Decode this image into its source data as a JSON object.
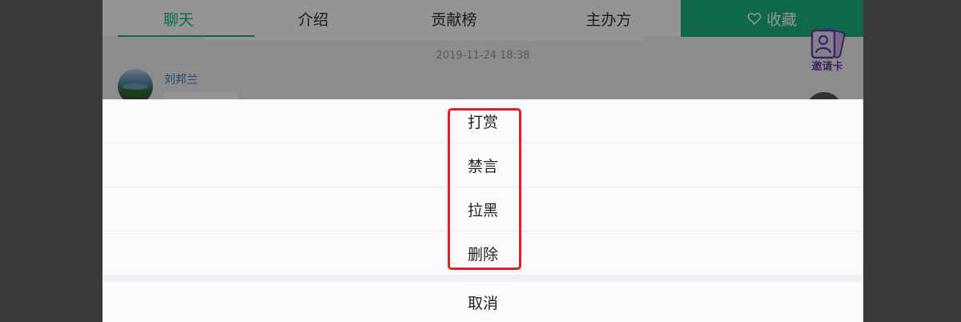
{
  "tabs": [
    {
      "label": "聊天",
      "active": true
    },
    {
      "label": "介绍",
      "active": false
    },
    {
      "label": "贡献榜",
      "active": false
    },
    {
      "label": "主办方",
      "active": false
    }
  ],
  "favorite": {
    "label": "收藏",
    "icon": "heart-outline-icon"
  },
  "chat": {
    "timestamp": "2019-11-24 18:38",
    "sender": "刘邦兰"
  },
  "invite_card": {
    "label": "邀请卡",
    "icon": "invite-card-icon"
  },
  "action_sheet": {
    "options": [
      "打赏",
      "禁言",
      "拉黑",
      "删除"
    ],
    "cancel_label": "取消"
  },
  "colors": {
    "accent": "#19b37e",
    "highlight": "#e51d24",
    "sender_name": "#3f7fc4",
    "invite": "#6a3fa8"
  }
}
